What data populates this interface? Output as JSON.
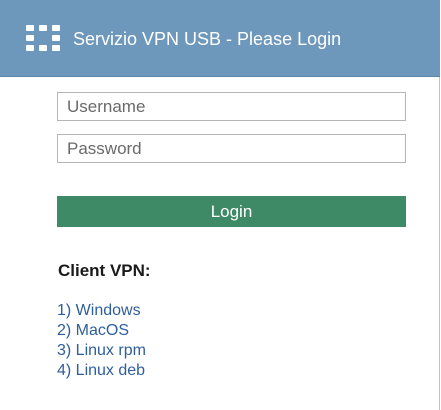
{
  "header": {
    "title": "Servizio VPN USB - Please Login",
    "icon": "grid-logo-icon",
    "background_color": "#6d98bb"
  },
  "login_form": {
    "username_placeholder": "Username",
    "password_placeholder": "Password",
    "login_label": "Login",
    "button_color": "#3f8a66"
  },
  "clients": {
    "title": "Client VPN:",
    "links": [
      {
        "label": "1) Windows"
      },
      {
        "label": "2) MacOS"
      },
      {
        "label": "3) Linux rpm"
      },
      {
        "label": "4) Linux deb"
      }
    ],
    "link_color": "#2e5e9c"
  }
}
